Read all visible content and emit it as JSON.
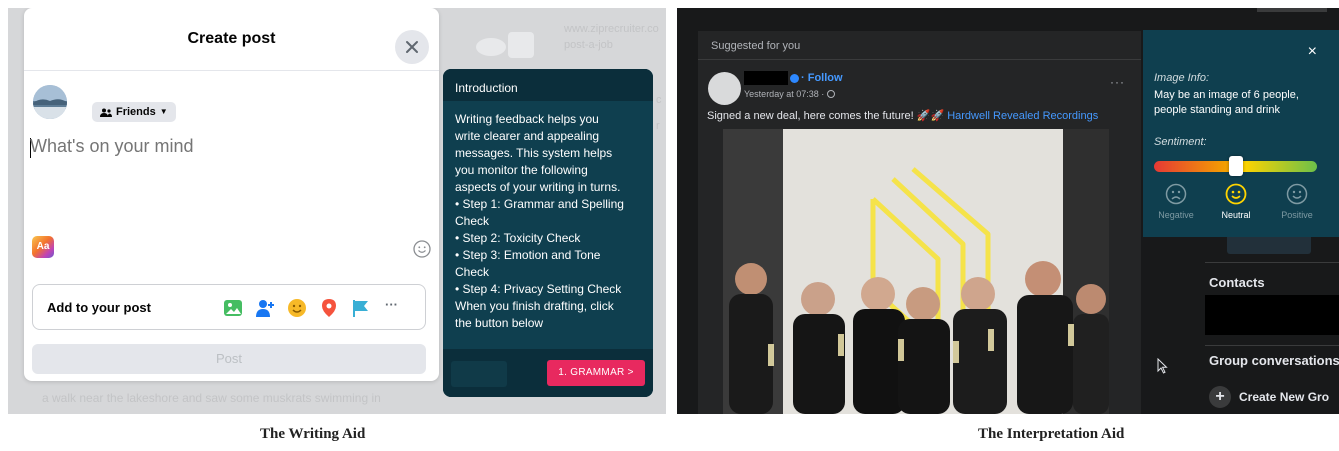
{
  "writing_aid": {
    "caption": "The Writing Aid",
    "composer": {
      "title": "Create post",
      "audience": "Friends",
      "placeholder": "What's on your mind",
      "aa_label": "Aa",
      "add_to_post": "Add to your post",
      "more_label": "···",
      "post_button": "Post",
      "icons": [
        "photo-icon",
        "tag-people-icon",
        "feeling-icon",
        "location-icon",
        "flag-icon",
        "more-icon"
      ]
    },
    "background": {
      "ad_line1": "www.ziprecruiter.co",
      "ad_line2": "post-a-job",
      "bottom_text": "a walk near the lakeshore and saw some muskrats swimming in"
    },
    "introduction": {
      "header": "Introduction",
      "lines": [
        "Writing feedback helps you",
        "write clearer and appealing",
        "messages. This system helps",
        "you monitor the following",
        "aspects of your writing in turns.",
        "• Step 1: Grammar and Spelling",
        "Check",
        "• Step 2: Toxicity Check",
        "• Step 3: Emotion and Tone",
        "Check",
        "• Step 4: Privacy Setting Check",
        "When you finish drafting, click",
        "the button below"
      ],
      "next_button": "1. GRAMMAR >"
    }
  },
  "interpretation_aid": {
    "caption": "The Interpretation Aid",
    "feed": {
      "suggested": "Suggested for you",
      "follow": "· Follow",
      "time": "Yesterday at 07:38 · ",
      "more": "···",
      "caption_text": "Signed a new deal, here comes the future! ",
      "caption_emoji": "🚀🚀",
      "caption_link": " Hardwell Revealed Recordings"
    },
    "sidebar": {
      "contacts": "Contacts",
      "group_conversations": "Group conversations",
      "create_group": "Create New Gro",
      "plus": "+"
    },
    "panel": {
      "close": "×",
      "image_info_label": "Image Info:",
      "image_info_text": "May be an image of 6 people, people standing and drink",
      "sentiment_label": "Sentiment:",
      "sentiment_value": 0.5,
      "labels": {
        "negative": "Negative",
        "neutral": "Neutral",
        "positive": "Positive"
      },
      "colors": {
        "panel": "#0f3f4f",
        "accent": "#ffd400",
        "button": "#e8295f"
      }
    }
  }
}
